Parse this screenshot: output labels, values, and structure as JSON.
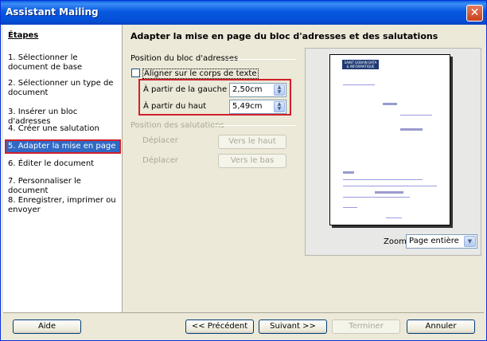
{
  "window": {
    "title": "Assistant Mailing",
    "close_glyph": "✕"
  },
  "sidebar": {
    "heading": "Étapes",
    "steps": [
      {
        "label": "1. Sélectionner le document de base"
      },
      {
        "label": "2. Sélectionner un type de document"
      },
      {
        "label": "3. Insérer un bloc d'adresses"
      },
      {
        "label": "4. Créer une salutation"
      },
      {
        "label": "5. Adapter la mise en page"
      },
      {
        "label": "6. Éditer le document"
      },
      {
        "label": "7. Personnaliser le document"
      },
      {
        "label": "8. Enregistrer, imprimer ou envoyer"
      }
    ],
    "active_index": 4
  },
  "main": {
    "title": "Adapter la mise en page du bloc d'adresses et des salutations",
    "address_group": {
      "label": "Position du bloc d'adresses",
      "align_checkbox": {
        "label": "Aligner sur le corps de texte",
        "checked": false
      },
      "from_left": {
        "label": "À partir de la gauche",
        "value": "2,50cm"
      },
      "from_top": {
        "label": "À partir du haut",
        "value": "5,49cm"
      }
    },
    "salutation_group": {
      "label": "Position des salutations",
      "move_label_1": "Déplacer",
      "move_up_button": "Vers le haut",
      "move_label_2": "Déplacer",
      "move_down_button": "Vers le bas"
    },
    "preview": {
      "logo_line1": "SAINT GOBAIN DATA",
      "logo_line2": "& INFORMATIQUE"
    },
    "zoom": {
      "label": "Zoom",
      "value": "Page entière"
    }
  },
  "footer": {
    "help": "Aide",
    "previous": "<< Précédent",
    "next": "Suivant >>",
    "finish": "Terminer",
    "cancel": "Annuler"
  },
  "colors": {
    "accent": "#316ac5",
    "highlight_box": "#d0202a",
    "title_bar": "#0858e0"
  }
}
